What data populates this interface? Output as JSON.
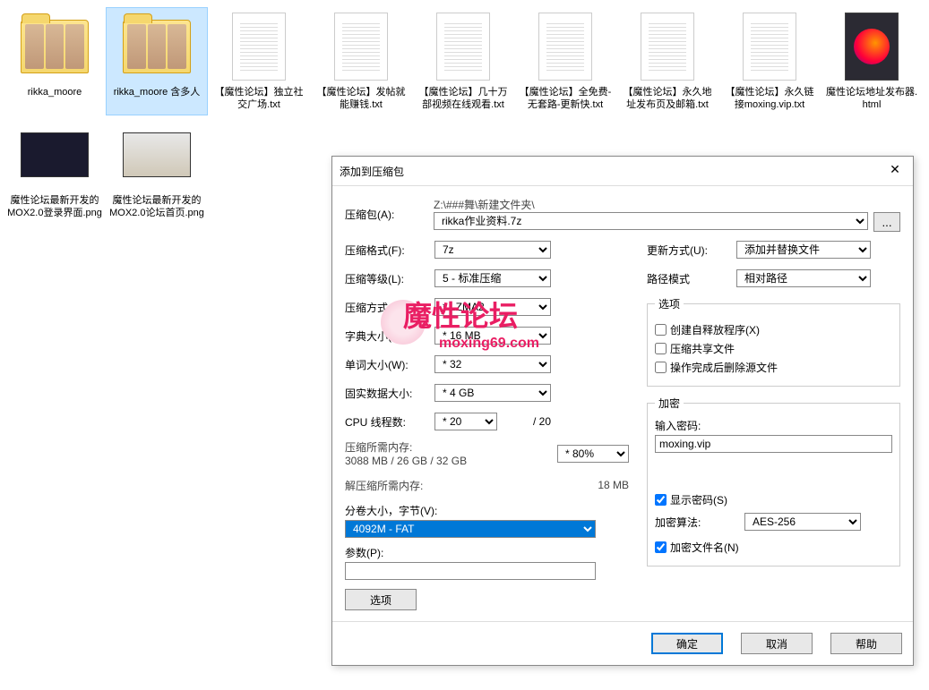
{
  "files": [
    {
      "name": "rikka_moore",
      "type": "folder-photos"
    },
    {
      "name": "rikka_moore 含多人",
      "type": "folder-photos",
      "selected": true
    },
    {
      "name": "【魔性论坛】独立社交广场.txt",
      "type": "txt"
    },
    {
      "name": "【魔性论坛】发帖就能赚钱.txt",
      "type": "txt"
    },
    {
      "name": "【魔性论坛】几十万部视频在线观看.txt",
      "type": "txt"
    },
    {
      "name": "【魔性论坛】全免费-无套路-更新快.txt",
      "type": "txt"
    },
    {
      "name": "【魔性论坛】永久地址发布页及邮箱.txt",
      "type": "txt"
    },
    {
      "name": "【魔性论坛】永久链接moxing.vip.txt",
      "type": "txt"
    },
    {
      "name": "魔性论坛地址发布器.html",
      "type": "html"
    },
    {
      "name": "魔性论坛最新开发的MOX2.0登录界面.png",
      "type": "png-dark"
    },
    {
      "name": "魔性论坛最新开发的MOX2.0论坛首页.png",
      "type": "png-light"
    }
  ],
  "dialog": {
    "title": "添加到压缩包",
    "close": "✕",
    "archive_label": "压缩包(A):",
    "archive_path": "Z:\\###舞\\新建文件夹\\",
    "archive_name": "rikka作业资料.7z",
    "browse": "...",
    "format_label": "压缩格式(F):",
    "format_value": "7z",
    "level_label": "压缩等级(L):",
    "level_value": "5 - 标准压缩",
    "method_label": "压缩方式(M):",
    "method_value": "* LZMA2",
    "dict_label": "字典大小(D):",
    "dict_value": "* 16 MB",
    "word_label": "单词大小(W):",
    "word_value": "* 32",
    "solid_label": "固实数据大小:",
    "solid_value": "* 4 GB",
    "cpu_label": "CPU 线程数:",
    "cpu_value": "* 20",
    "cpu_max": "/ 20",
    "mem_compress_label": "压缩所需内存:",
    "mem_compress_value": "3088 MB / 26 GB / 32 GB",
    "mem_compress_pct": "* 80%",
    "mem_decompress_label": "解压缩所需内存:",
    "mem_decompress_value": "18 MB",
    "split_label": "分卷大小，字节(V):",
    "split_value": "4092M - FAT",
    "params_label": "参数(P):",
    "params_value": "",
    "options_btn": "选项",
    "update_label": "更新方式(U):",
    "update_value": "添加并替换文件",
    "path_label": "路径模式",
    "path_value": "相对路径",
    "options_legend": "选项",
    "opt_sfx": "创建自释放程序(X)",
    "opt_shared": "压缩共享文件",
    "opt_delete": "操作完成后删除源文件",
    "enc_legend": "加密",
    "enc_pwd_label": "输入密码:",
    "enc_pwd_value": "moxing.vip",
    "enc_show": "显示密码(S)",
    "enc_method_label": "加密算法:",
    "enc_method_value": "AES-256",
    "enc_filenames": "加密文件名(N)",
    "ok": "确定",
    "cancel": "取消",
    "help": "帮助"
  },
  "watermark": {
    "main": "魔性论坛",
    "sub": "moxing69.com"
  }
}
